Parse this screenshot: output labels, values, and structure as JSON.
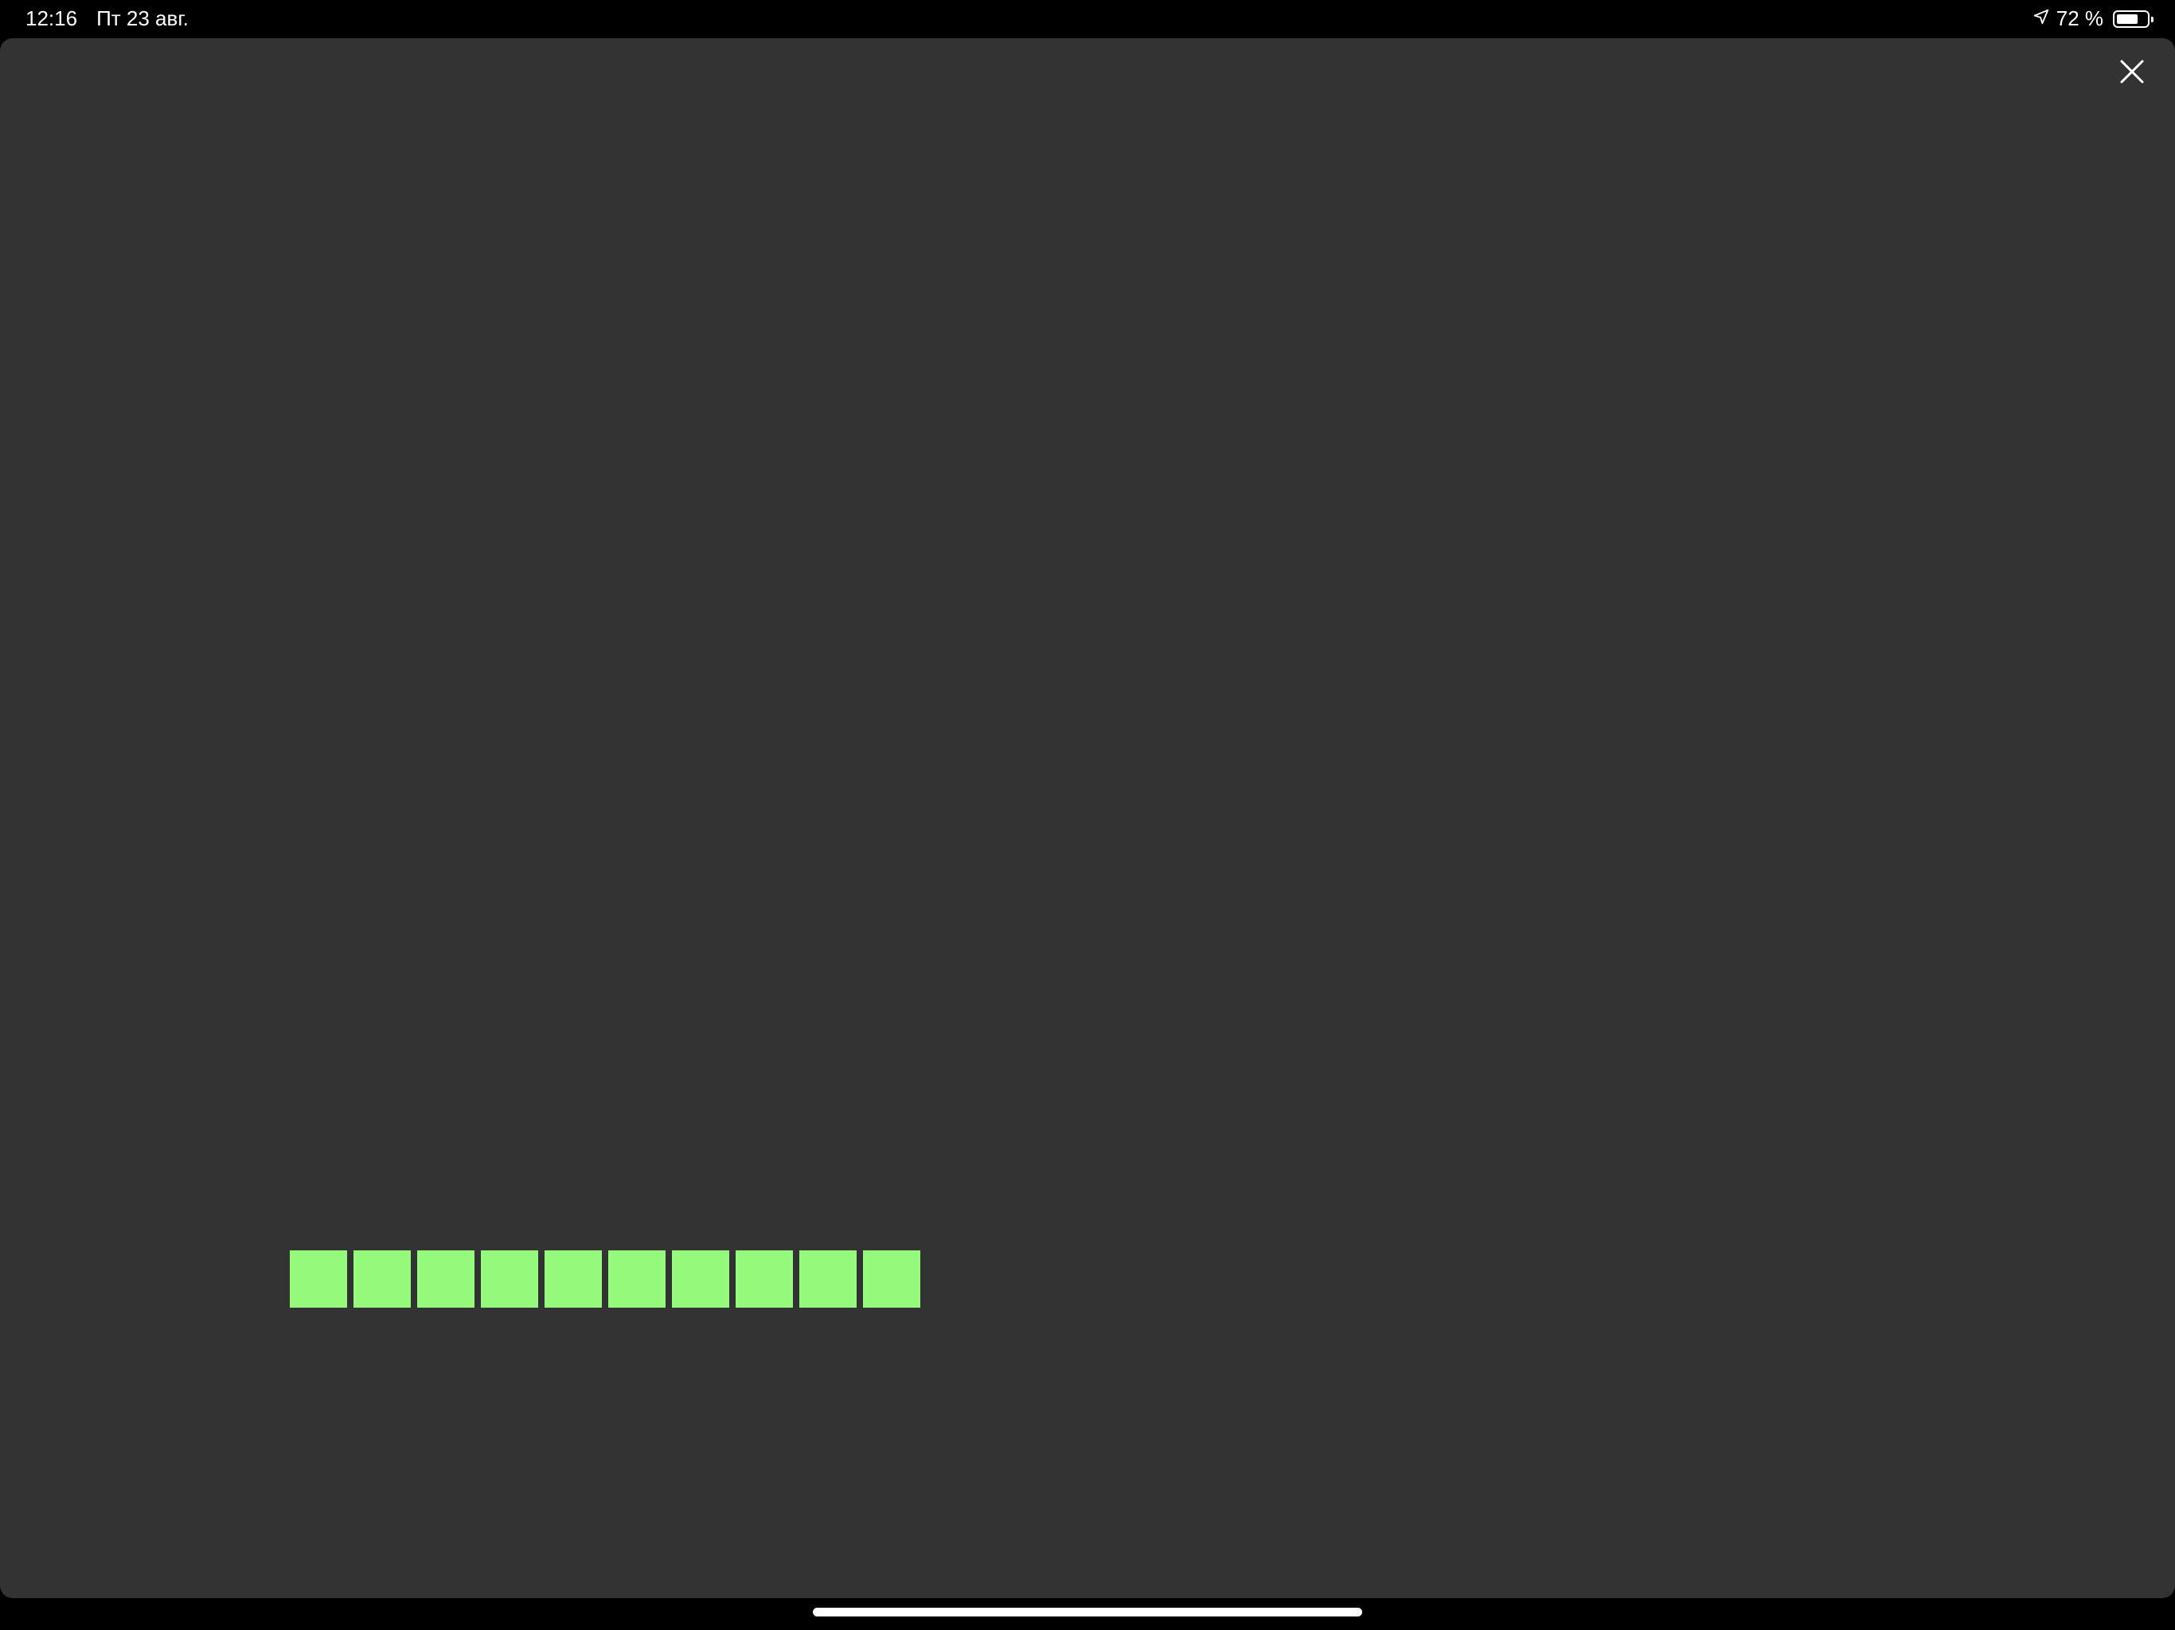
{
  "status_bar": {
    "time": "12:16",
    "date": "Пт 23 авг.",
    "battery_percent": "72 %",
    "battery_level": 0.72,
    "location_icon": "location-arrow-icon",
    "battery_icon": "battery-icon"
  },
  "close": {
    "icon": "close-icon"
  },
  "progress": {
    "block_count": 10,
    "block_color": "#95f97c"
  },
  "colors": {
    "background": "#333333",
    "status_bar": "#000000"
  }
}
